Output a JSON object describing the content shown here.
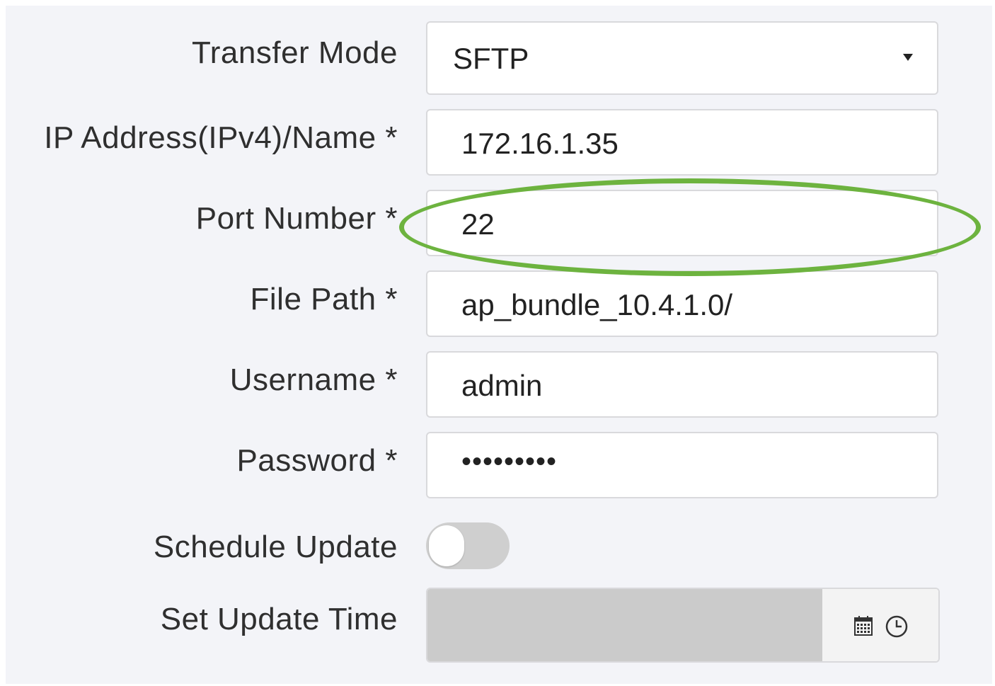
{
  "form": {
    "transfer_mode": {
      "label": "Transfer Mode",
      "value": "SFTP"
    },
    "ip_address": {
      "label": "IP Address(IPv4)/Name *",
      "value": "172.16.1.35"
    },
    "port_number": {
      "label": "Port Number *",
      "value": "22"
    },
    "file_path": {
      "label": "File Path *",
      "value": "ap_bundle_10.4.1.0/"
    },
    "username": {
      "label": "Username *",
      "value": "admin"
    },
    "password": {
      "label": "Password *",
      "value": "•••••••••"
    },
    "schedule_update": {
      "label": "Schedule Update",
      "enabled": false
    },
    "set_update_time": {
      "label": "Set Update Time",
      "value": "",
      "icons": [
        "calendar-icon",
        "clock-icon"
      ]
    }
  },
  "highlight": {
    "color": "#6db33f",
    "target": "port-number-field"
  }
}
